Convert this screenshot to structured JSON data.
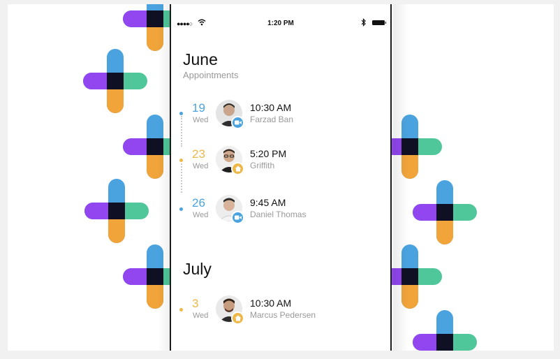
{
  "colors": {
    "blue": "#4aa3df",
    "yellow": "#ecb84a",
    "purple": "#9146ef",
    "orange": "#f0a43a",
    "green": "#4fc79b",
    "dark": "#111111",
    "muted": "#9a9a9a"
  },
  "status_bar": {
    "time": "1:20 PM",
    "signal_icon": "signal-dots-icon",
    "wifi_icon": "wifi-icon",
    "bluetooth_icon": "bluetooth-icon",
    "battery_icon": "battery-icon"
  },
  "sections": [
    {
      "month": "June",
      "subtitle": "Appointments",
      "appointments": [
        {
          "day": "19",
          "weekday": "Wed",
          "time": "10:30 AM",
          "person": "Farzad Ban",
          "type_icon": "video-camera-icon",
          "accent": "#4aa3df"
        },
        {
          "day": "23",
          "weekday": "Wed",
          "time": "5:20 PM",
          "person": "Griffith",
          "type_icon": "home-icon",
          "accent": "#ecb84a"
        },
        {
          "day": "26",
          "weekday": "Wed",
          "time": "9:45 AM",
          "person": "Daniel Thomas",
          "type_icon": "video-camera-icon",
          "accent": "#4aa3df"
        }
      ]
    },
    {
      "month": "July",
      "appointments": [
        {
          "day": "3",
          "weekday": "Wed",
          "time": "10:30 AM",
          "person": "Marcus Pedersen",
          "type_icon": "home-icon",
          "accent": "#ecb84a"
        }
      ]
    }
  ]
}
